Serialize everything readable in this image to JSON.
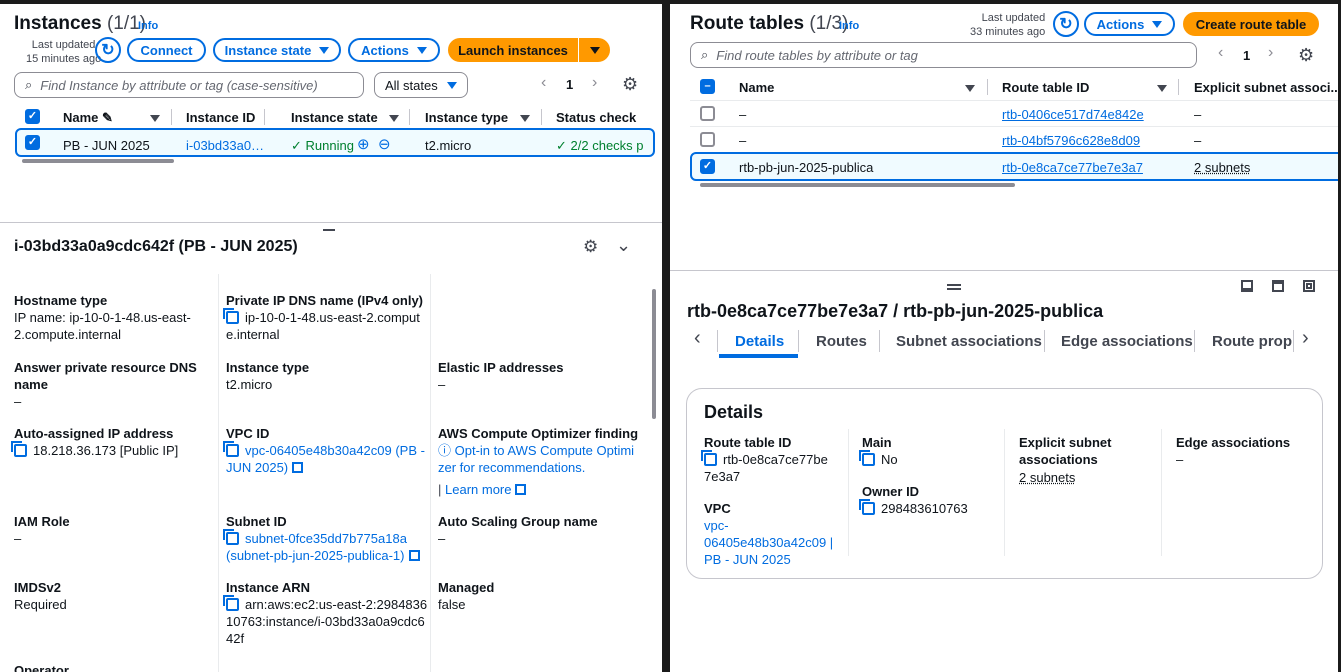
{
  "instances": {
    "title": "Instances",
    "count": "(1/1)",
    "info": "Info",
    "last_updated_label": "Last updated",
    "last_updated_value": "15 minutes ago",
    "buttons": {
      "connect": "Connect",
      "instance_state": "Instance state",
      "actions": "Actions",
      "launch": "Launch instances"
    },
    "search_placeholder": "Find Instance by attribute or tag (case-sensitive)",
    "filter": "All states",
    "page": "1",
    "columns": [
      "Name",
      "Instance ID",
      "Instance state",
      "Instance type",
      "Status check"
    ],
    "row": {
      "name": "PB - JUN 2025",
      "id": "i-03bd33a0…",
      "state": "Running",
      "type": "t2.micro",
      "status": "2/2 checks p"
    }
  },
  "details": {
    "title": "i-03bd33a0a9cdc642f (PB - JUN 2025)",
    "fields": {
      "hostname_label": "Hostname type",
      "hostname_value1": "IP name: ip-10-0-1-48.us-east-",
      "hostname_value2": "2.compute.internal",
      "privdns_label": "Private IP DNS name (IPv4 only)",
      "privdns_value1": "ip-10-0-1-48.us-east-2.comput",
      "privdns_value2": "e.internal",
      "answer_label1": "Answer private resource DNS",
      "answer_label2": "name",
      "answer_value": "–",
      "itype_label": "Instance type",
      "itype_value": "t2.micro",
      "eip_label": "Elastic IP addresses",
      "eip_value": "–",
      "autoip_label": "Auto-assigned IP address",
      "autoip_value": "18.218.36.173 [Public IP]",
      "vpc_label": "VPC ID",
      "vpc_value1": "vpc-06405e48b30a42c09 (PB -",
      "vpc_value2": "JUN 2025)",
      "opt_label": "AWS Compute Optimizer finding",
      "opt_value1": "Opt-in to AWS Compute Optimi",
      "opt_value2": "zer for recommendations.",
      "opt_learn": "Learn more",
      "iam_label": "IAM Role",
      "iam_value": "–",
      "subnet_label": "Subnet ID",
      "subnet_value1": "subnet-0fce35dd7b775a18a",
      "subnet_value2": "(subnet-pb-jun-2025-publica-1)",
      "asg_label": "Auto Scaling Group name",
      "asg_value": "–",
      "imds_label": "IMDSv2",
      "imds_value": "Required",
      "arn_label": "Instance ARN",
      "arn_value1": "arn:aws:ec2:us-east-2:2984836",
      "arn_value2": "10763:instance/i-03bd33a0a9cdc6",
      "arn_value3": "42f",
      "managed_label": "Managed",
      "managed_value": "false",
      "operator_label": "Operator"
    }
  },
  "route_tables": {
    "title": "Route tables",
    "count": "(1/3)",
    "info": "Info",
    "last_updated_label": "Last updated",
    "last_updated_value": "33 minutes ago",
    "buttons": {
      "actions": "Actions",
      "create": "Create route table"
    },
    "search_placeholder": "Find route tables by attribute or tag",
    "page": "1",
    "columns": [
      "Name",
      "Route table ID",
      "Explicit subnet associ..."
    ],
    "rows": [
      {
        "name": "–",
        "id": "rtb-0406ce517d74e842e",
        "assoc": "–"
      },
      {
        "name": "–",
        "id": "rtb-04bf5796c628e8d09",
        "assoc": "–"
      },
      {
        "name": "rtb-pb-jun-2025-publica",
        "id": "rtb-0e8ca7ce77be7e3a7",
        "assoc": "2 subnets"
      }
    ]
  },
  "rt_detail": {
    "title": "rtb-0e8ca7ce77be7e3a7 / rtb-pb-jun-2025-publica",
    "tabs": [
      "Details",
      "Routes",
      "Subnet associations",
      "Edge associations",
      "Route propa"
    ],
    "card_title": "Details",
    "rtid_label": "Route table ID",
    "rtid_value1": "rtb-0e8ca7ce77be",
    "rtid_value2": "7e3a7",
    "main_label": "Main",
    "main_value": "No",
    "explicit_label1": "Explicit subnet",
    "explicit_label2": "associations",
    "explicit_value": "2 subnets",
    "edge_label": "Edge associations",
    "edge_value": "–",
    "vpc_label": "VPC",
    "vpc_value1": "vpc-",
    "vpc_value2": "06405e48b30a42c09 |",
    "vpc_value3": "PB - JUN 2025",
    "owner_label": "Owner ID",
    "owner_value": "298483610763"
  }
}
